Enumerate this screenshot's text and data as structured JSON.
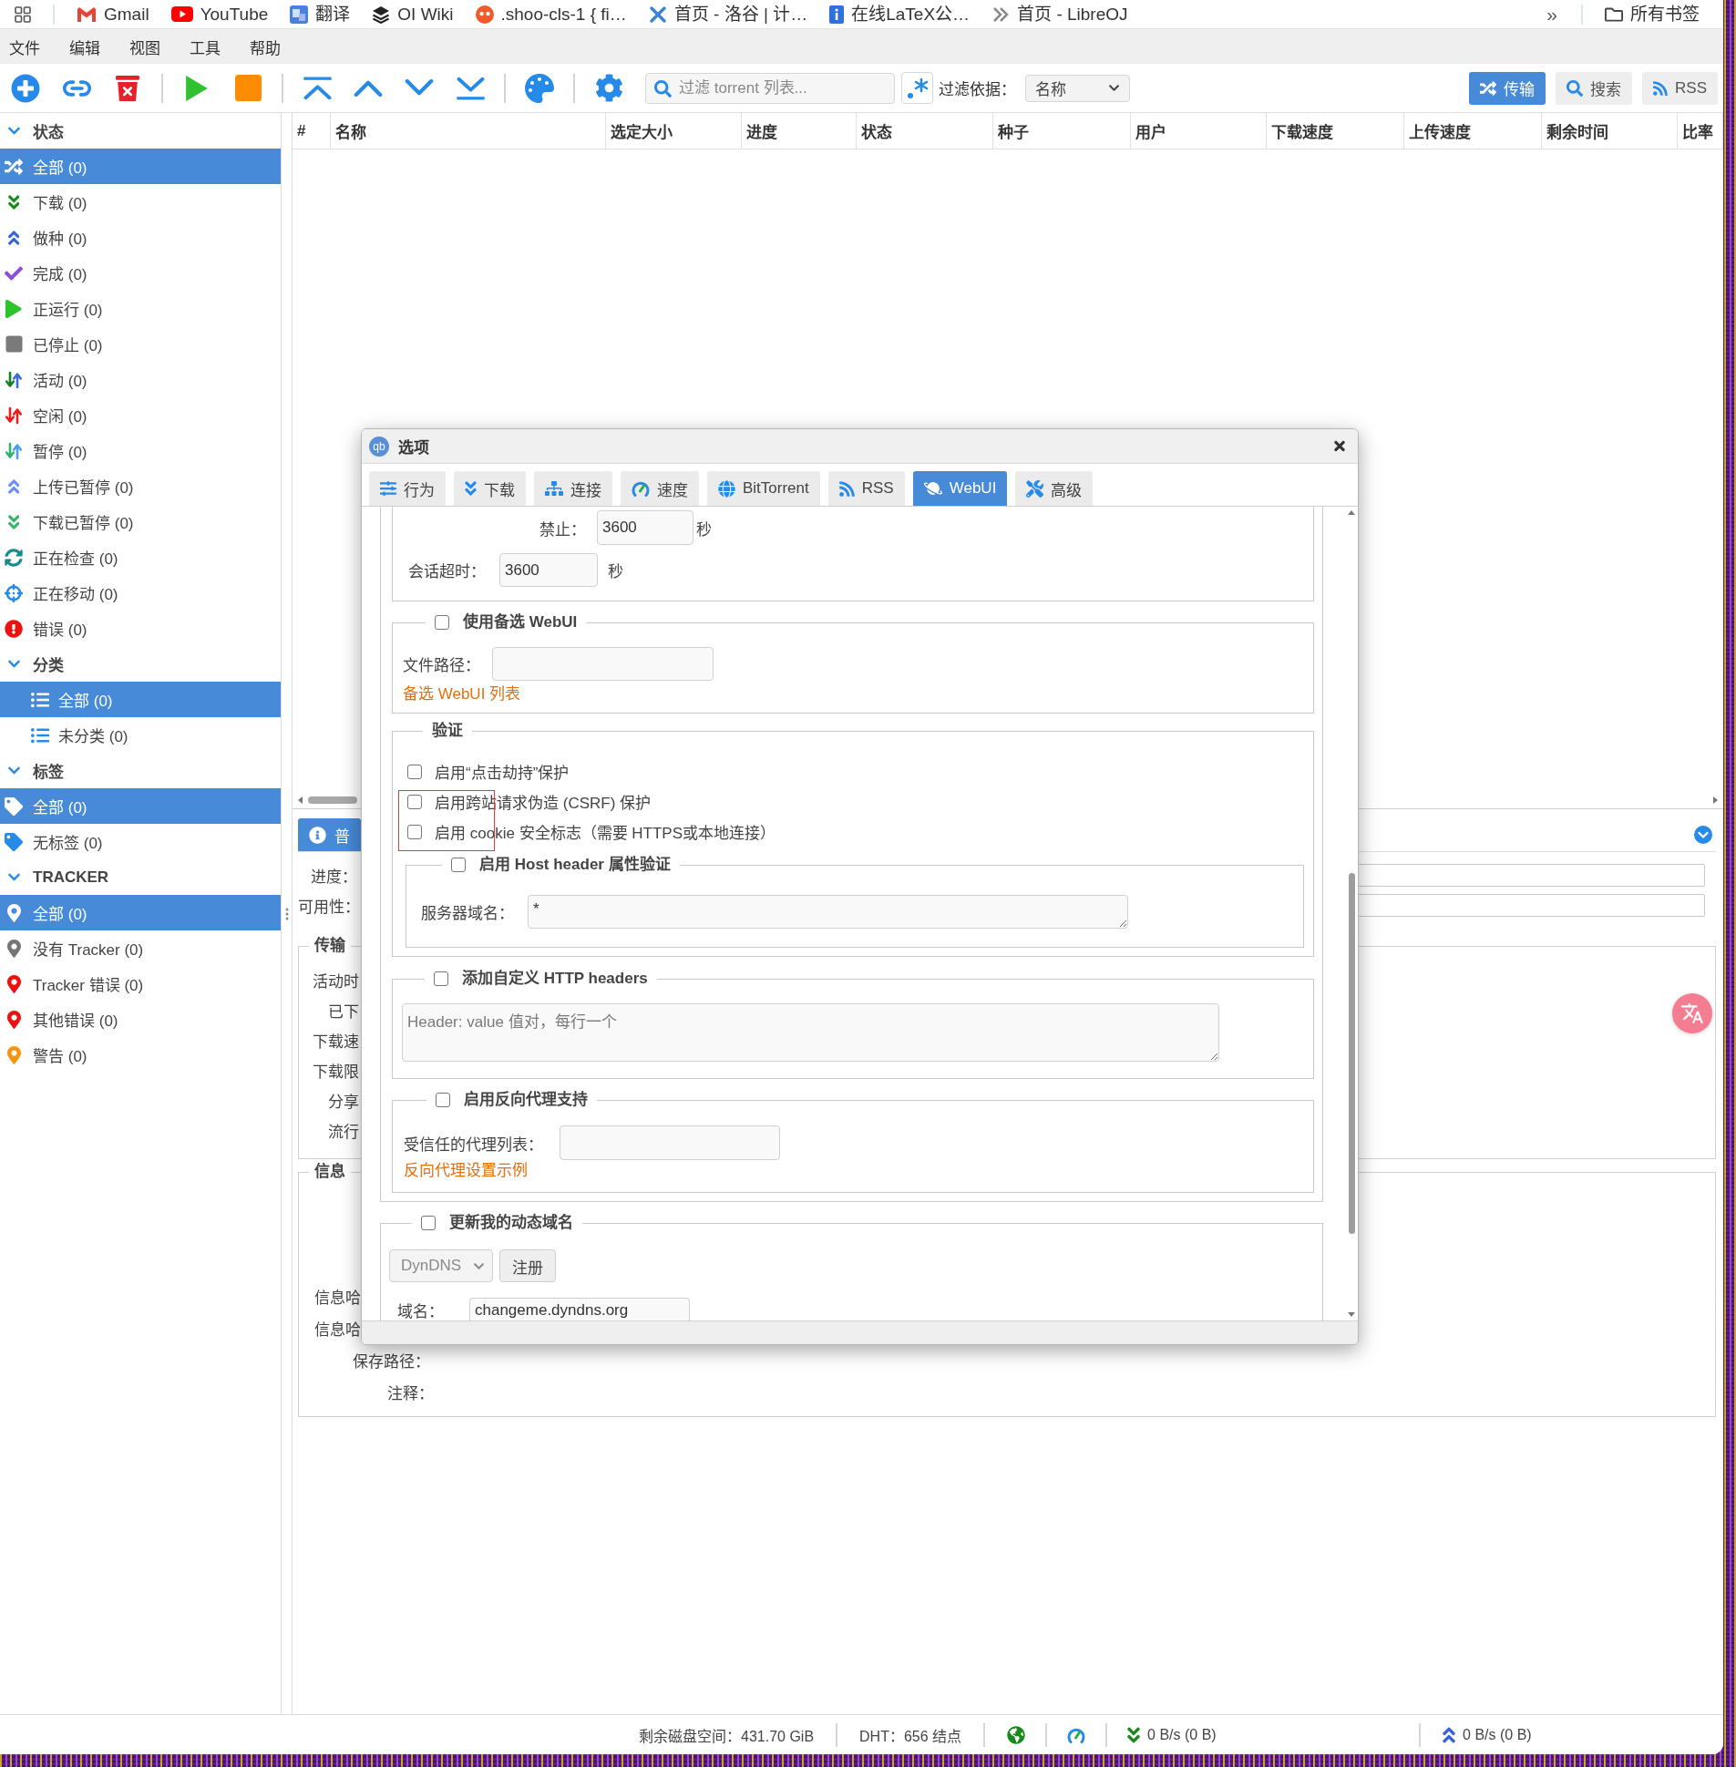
{
  "bookmarks_bar": {
    "items": [
      {
        "label": "Gmail"
      },
      {
        "label": "YouTube"
      },
      {
        "label": "翻译"
      },
      {
        "label": "OI Wiki"
      },
      {
        "label": ".shoo-cls-1 { fi…"
      },
      {
        "label": "首页 - 洛谷 | 计…"
      },
      {
        "label": "在线LaTeX公…"
      },
      {
        "label": "首页 - LibreOJ"
      }
    ],
    "more": "»",
    "all_bookmarks": "所有书签"
  },
  "menu_bar": {
    "items": [
      "文件",
      "编辑",
      "视图",
      "工具",
      "帮助"
    ]
  },
  "toolbar": {
    "search": {
      "placeholder": "过滤 torrent 列表..."
    },
    "filter_label": "过滤依据：",
    "filter_by": "名称",
    "views": [
      {
        "label": "传输",
        "selected": true
      },
      {
        "label": "搜索",
        "selected": false
      },
      {
        "label": "RSS",
        "selected": false
      }
    ]
  },
  "sidebar": {
    "sections": [
      {
        "title": "状态",
        "kind": "status",
        "expanded": true,
        "items": [
          {
            "label": "全部 (0)",
            "selected": true
          },
          {
            "label": "下载 (0)",
            "selected": false
          },
          {
            "label": "做种 (0)",
            "selected": false
          },
          {
            "label": "完成 (0)",
            "selected": false
          },
          {
            "label": "正运行 (0)",
            "selected": false
          },
          {
            "label": "已停止 (0)",
            "selected": false
          },
          {
            "label": "活动 (0)",
            "selected": false
          },
          {
            "label": "空闲 (0)",
            "selected": false
          },
          {
            "label": "暂停 (0)",
            "selected": false
          },
          {
            "label": "上传已暂停 (0)",
            "selected": false
          },
          {
            "label": "下载已暂停 (0)",
            "selected": false
          },
          {
            "label": "正在检查 (0)",
            "selected": false
          },
          {
            "label": "正在移动 (0)",
            "selected": false
          },
          {
            "label": "错误 (0)",
            "selected": false
          }
        ]
      },
      {
        "title": "分类",
        "kind": "categories",
        "expanded": true,
        "items": [
          {
            "label": "全部 (0)",
            "selected": true
          },
          {
            "label": "未分类 (0)",
            "selected": false
          }
        ]
      },
      {
        "title": "标签",
        "kind": "tags",
        "expanded": true,
        "items": [
          {
            "label": "全部 (0)",
            "selected": true
          },
          {
            "label": "无标签 (0)",
            "selected": false
          }
        ]
      },
      {
        "title": "TRACKER",
        "kind": "trackers",
        "expanded": true,
        "items": [
          {
            "label": "全部 (0)",
            "selected": true
          },
          {
            "label": "没有 Tracker (0)",
            "selected": false
          },
          {
            "label": "Tracker 错误 (0)",
            "selected": false
          },
          {
            "label": "其他错误 (0)",
            "selected": false
          },
          {
            "label": "警告 (0)",
            "selected": false
          }
        ]
      }
    ]
  },
  "torrent_table": {
    "columns": [
      "#",
      "名称",
      "选定大小",
      "进度",
      "状态",
      "种子",
      "用户",
      "下载速度",
      "上传速度",
      "剩余时间",
      "比率"
    ]
  },
  "details_panel": {
    "tabs": [
      {
        "label": "普",
        "selected": true
      }
    ],
    "fields": [
      {
        "label": "进度："
      },
      {
        "label": "可用性："
      }
    ],
    "transfer": {
      "title": "传输",
      "labels": [
        "活动时",
        "已下",
        "下载速",
        "下载限",
        "分享",
        "流行"
      ]
    },
    "info": {
      "title": "信息",
      "labels": [
        "信息哈",
        "信息哈",
        "保存路径：",
        "注释："
      ]
    }
  },
  "options_dialog": {
    "logo": "qb",
    "title": "选项",
    "tabs": [
      {
        "label": "行为",
        "selected": false
      },
      {
        "label": "下载",
        "selected": false
      },
      {
        "label": "连接",
        "selected": false
      },
      {
        "label": "速度",
        "selected": false
      },
      {
        "label": "BitTorrent",
        "selected": false
      },
      {
        "label": "RSS",
        "selected": false
      },
      {
        "label": "WebUI",
        "selected": true
      },
      {
        "label": "高级",
        "selected": false
      }
    ],
    "ban": {
      "label": "禁止：",
      "value": "3600",
      "unit": "秒"
    },
    "session_timeout": {
      "label": "会话超时：",
      "value": "3600",
      "unit": "秒"
    },
    "alt_webui": {
      "title": "使用备选 WebUI",
      "checked": false,
      "path_label": "文件路径：",
      "link": "备选 WebUI 列表"
    },
    "authentication": {
      "title": "验证",
      "options": [
        {
          "label": "启用“点击劫持”保护",
          "checked": false,
          "highlighted": false
        },
        {
          "label": "启用跨站请求伪造 (CSRF) 保护",
          "checked": false,
          "highlighted": true
        },
        {
          "label": "启用 cookie 安全标志（需要 HTTPS或本地连接）",
          "checked": false,
          "highlighted": true
        }
      ],
      "host_header": {
        "title": "启用 Host header 属性验证",
        "checked": false,
        "domains_label": "服务器域名：",
        "domains_value": "*"
      }
    },
    "custom_headers": {
      "title": "添加自定义 HTTP headers",
      "checked": false,
      "placeholder": "Header: value 值对，每行一个"
    },
    "reverse_proxy": {
      "title": "启用反向代理支持",
      "checked": false,
      "trusted_label": "受信任的代理列表：",
      "link": "反向代理设置示例"
    },
    "dyndns": {
      "title": "更新我的动态域名",
      "checked": false,
      "service": {
        "value": "DynDNS",
        "disabled": true
      },
      "register": "注册",
      "domain_label": "域名：",
      "domain_value": "changeme.dyndns.org"
    }
  },
  "status_bar": {
    "free_space": "剩余磁盘空间：431.70 GiB",
    "dht": "DHT：656 结点",
    "download_rate": "0 B/s (0 B)",
    "upload_rate": "0 B/s (0 B)"
  }
}
